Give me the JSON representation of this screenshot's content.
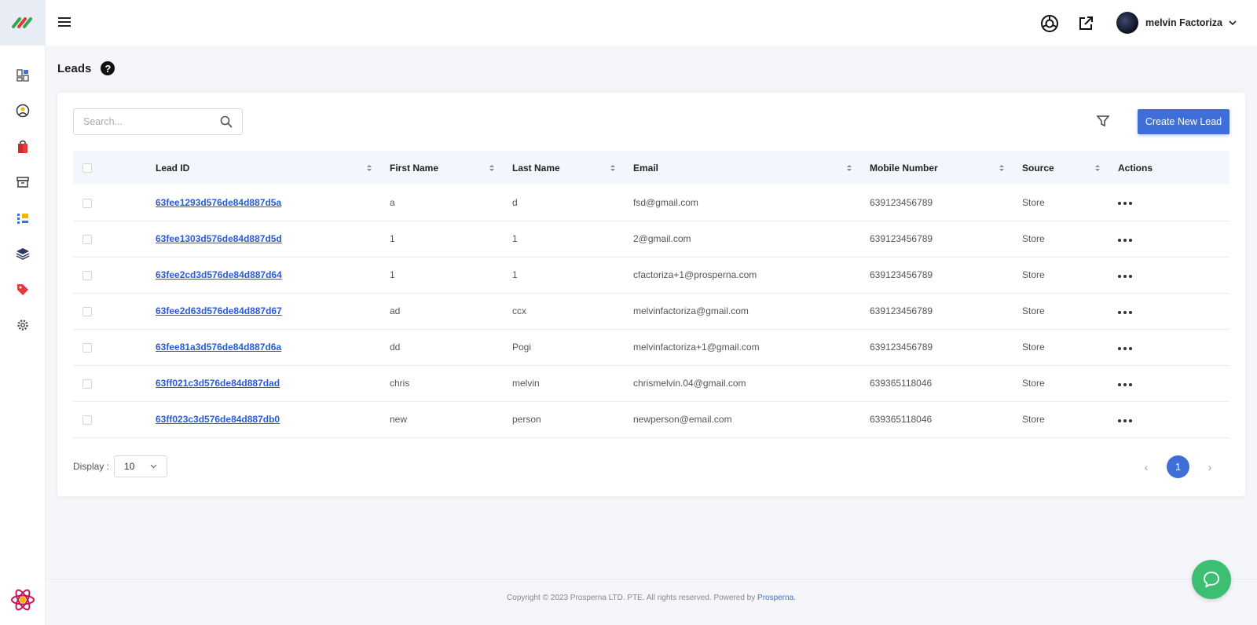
{
  "header": {
    "user_name": "melvin Factoriza",
    "icons": [
      "menu-icon",
      "support-icon",
      "external-link-icon",
      "chevron-down-icon"
    ]
  },
  "sidebar": {
    "items": [
      {
        "icon": "dashboard-icon"
      },
      {
        "icon": "user-circle-icon"
      },
      {
        "icon": "shopping-bag-icon"
      },
      {
        "icon": "archive-icon"
      },
      {
        "icon": "list-icon"
      },
      {
        "icon": "layers-icon"
      },
      {
        "icon": "tag-icon"
      },
      {
        "icon": "settings-icon"
      }
    ]
  },
  "page": {
    "title": "Leads",
    "help": "?"
  },
  "search": {
    "placeholder": "Search..."
  },
  "create_button": "Create New Lead",
  "table": {
    "columns": [
      "Lead ID",
      "First Name",
      "Last Name",
      "Email",
      "Mobile Number",
      "Source",
      "Actions"
    ],
    "rows": [
      {
        "id": "63fee1293d576de84d887d5a",
        "first": "a",
        "last": "d",
        "email": "fsd@gmail.com",
        "mobile": "639123456789",
        "source": "Store"
      },
      {
        "id": "63fee1303d576de84d887d5d",
        "first": "1",
        "last": "1",
        "email": "2@gmail.com",
        "mobile": "639123456789",
        "source": "Store"
      },
      {
        "id": "63fee2cd3d576de84d887d64",
        "first": "1",
        "last": "1",
        "email": "cfactoriza+1@prosperna.com",
        "mobile": "639123456789",
        "source": "Store"
      },
      {
        "id": "63fee2d63d576de84d887d67",
        "first": "ad",
        "last": "ccx",
        "email": "melvinfactoriza@gmail.com",
        "mobile": "639123456789",
        "source": "Store"
      },
      {
        "id": "63fee81a3d576de84d887d6a",
        "first": "dd",
        "last": "Pogi",
        "email": "melvinfactoriza+1@gmail.com",
        "mobile": "639123456789",
        "source": "Store"
      },
      {
        "id": "63ff021c3d576de84d887dad",
        "first": "chris",
        "last": "melvin",
        "email": "chrismelvin.04@gmail.com",
        "mobile": "639365118046",
        "source": "Store"
      },
      {
        "id": "63ff023c3d576de84d887db0",
        "first": "new",
        "last": "person",
        "email": "newperson@email.com",
        "mobile": "639365118046",
        "source": "Store"
      }
    ]
  },
  "display": {
    "label": "Display :",
    "value": "10"
  },
  "pagination": {
    "current": "1",
    "prev": "‹",
    "next": "›"
  },
  "footer": {
    "text": "Copyright © 2023 Prosperna LTD. PTE. All rights reserved. Powered by ",
    "link": "Prosperna",
    "end": "."
  },
  "colors": {
    "primary": "#3e6fd8",
    "chat": "#3dbf73",
    "link": "#2a5bd7"
  }
}
